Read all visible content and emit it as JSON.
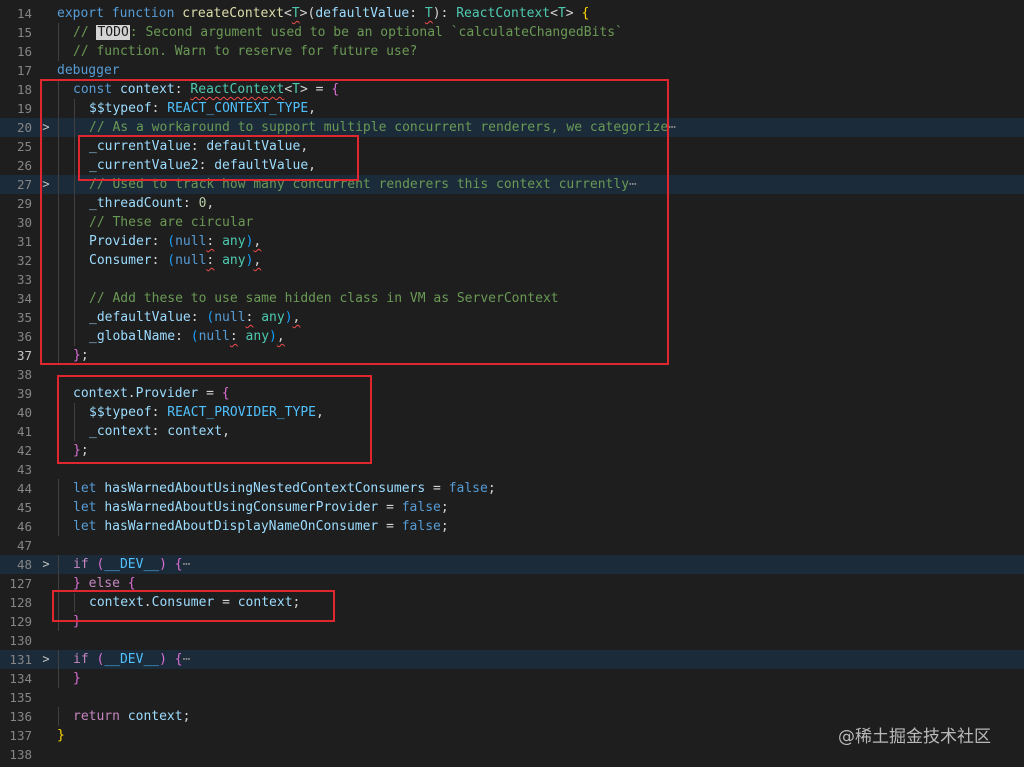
{
  "lines": [
    {
      "num": "14",
      "fold": "",
      "guides": [],
      "folded": false,
      "tokens": [
        {
          "c": "k",
          "t": "export"
        },
        {
          "c": "p",
          "t": " "
        },
        {
          "c": "k",
          "t": "function"
        },
        {
          "c": "p",
          "t": " "
        },
        {
          "c": "f",
          "t": "createContext"
        },
        {
          "c": "p",
          "t": "<"
        },
        {
          "c": "t sq",
          "t": "T"
        },
        {
          "c": "p",
          "t": ">("
        },
        {
          "c": "v",
          "t": "defaultValue"
        },
        {
          "c": "p",
          "t": ": "
        },
        {
          "c": "t sq",
          "t": "T"
        },
        {
          "c": "p",
          "t": "): "
        },
        {
          "c": "t",
          "t": "ReactContext"
        },
        {
          "c": "p",
          "t": "<"
        },
        {
          "c": "t",
          "t": "T"
        },
        {
          "c": "p",
          "t": "> "
        },
        {
          "c": "b1",
          "t": "{"
        }
      ]
    },
    {
      "num": "15",
      "fold": "",
      "guides": [
        16
      ],
      "folded": false,
      "tokens": [
        {
          "c": "c",
          "t": "// "
        },
        {
          "c": "todo",
          "t": "TODO"
        },
        {
          "c": "c",
          "t": ": Second argument used to be an optional `calculateChangedBits`"
        }
      ]
    },
    {
      "num": "16",
      "fold": "",
      "guides": [
        16
      ],
      "folded": false,
      "tokens": [
        {
          "c": "c",
          "t": "// function. Warn to reserve for future use?"
        }
      ]
    },
    {
      "num": "17",
      "fold": "",
      "guides": [],
      "folded": false,
      "tokens": [
        {
          "c": "k",
          "t": "debugger"
        }
      ]
    },
    {
      "num": "18",
      "fold": "",
      "guides": [
        16
      ],
      "folded": false,
      "tokens": [
        {
          "c": "k",
          "t": "const"
        },
        {
          "c": "p",
          "t": " "
        },
        {
          "c": "v",
          "t": "context"
        },
        {
          "c": "p",
          "t": ": "
        },
        {
          "c": "t sq",
          "t": "ReactContext"
        },
        {
          "c": "p",
          "t": "<"
        },
        {
          "c": "t",
          "t": "T"
        },
        {
          "c": "p",
          "t": "> = "
        },
        {
          "c": "b2",
          "t": "{"
        }
      ]
    },
    {
      "num": "19",
      "fold": "",
      "guides": [
        16,
        32
      ],
      "folded": false,
      "tokens": [
        {
          "c": "v",
          "t": "$$typeof"
        },
        {
          "c": "p",
          "t": ": "
        },
        {
          "c": "cst",
          "t": "REACT_CONTEXT_TYPE"
        },
        {
          "c": "p",
          "t": ","
        }
      ]
    },
    {
      "num": "20",
      "fold": ">",
      "guides": [
        16,
        32
      ],
      "folded": true,
      "tokens": [
        {
          "c": "c",
          "t": "// As a workaround to support multiple concurrent renderers, we categorize"
        },
        {
          "c": "ell",
          "t": "⋯"
        }
      ]
    },
    {
      "num": "25",
      "fold": "",
      "guides": [
        16,
        32
      ],
      "folded": false,
      "tokens": [
        {
          "c": "v",
          "t": "_currentValue"
        },
        {
          "c": "p",
          "t": ": "
        },
        {
          "c": "v",
          "t": "defaultValue"
        },
        {
          "c": "p",
          "t": ","
        }
      ]
    },
    {
      "num": "26",
      "fold": "",
      "guides": [
        16,
        32
      ],
      "folded": false,
      "tokens": [
        {
          "c": "v",
          "t": "_currentValue2"
        },
        {
          "c": "p",
          "t": ": "
        },
        {
          "c": "v",
          "t": "defaultValue"
        },
        {
          "c": "p",
          "t": ","
        }
      ]
    },
    {
      "num": "27",
      "fold": ">",
      "guides": [
        16,
        32
      ],
      "folded": true,
      "tokens": [
        {
          "c": "c",
          "t": "// Used to track how many concurrent renderers this context currently"
        },
        {
          "c": "ell",
          "t": "⋯"
        }
      ]
    },
    {
      "num": "29",
      "fold": "",
      "guides": [
        16,
        32
      ],
      "folded": false,
      "tokens": [
        {
          "c": "v",
          "t": "_threadCount"
        },
        {
          "c": "p",
          "t": ": "
        },
        {
          "c": "n",
          "t": "0"
        },
        {
          "c": "p",
          "t": ","
        }
      ]
    },
    {
      "num": "30",
      "fold": "",
      "guides": [
        16,
        32
      ],
      "folded": false,
      "tokens": [
        {
          "c": "c",
          "t": "// These are circular"
        }
      ]
    },
    {
      "num": "31",
      "fold": "",
      "guides": [
        16,
        32
      ],
      "folded": false,
      "tokens": [
        {
          "c": "v",
          "t": "Provider"
        },
        {
          "c": "p",
          "t": ": "
        },
        {
          "c": "b3",
          "t": "("
        },
        {
          "c": "k",
          "t": "null"
        },
        {
          "c": "p sq",
          "t": ":"
        },
        {
          "c": "p",
          "t": " "
        },
        {
          "c": "t",
          "t": "any"
        },
        {
          "c": "b3",
          "t": ")"
        },
        {
          "c": "p sq",
          "t": ","
        }
      ]
    },
    {
      "num": "32",
      "fold": "",
      "guides": [
        16,
        32
      ],
      "folded": false,
      "tokens": [
        {
          "c": "v",
          "t": "Consumer"
        },
        {
          "c": "p",
          "t": ": "
        },
        {
          "c": "b3",
          "t": "("
        },
        {
          "c": "k",
          "t": "null"
        },
        {
          "c": "p sq",
          "t": ":"
        },
        {
          "c": "p",
          "t": " "
        },
        {
          "c": "t",
          "t": "any"
        },
        {
          "c": "b3",
          "t": ")"
        },
        {
          "c": "p sq",
          "t": ","
        }
      ]
    },
    {
      "num": "33",
      "fold": "",
      "guides": [
        16,
        32
      ],
      "folded": false,
      "tokens": []
    },
    {
      "num": "34",
      "fold": "",
      "guides": [
        16,
        32
      ],
      "folded": false,
      "tokens": [
        {
          "c": "c",
          "t": "// Add these to use same hidden class in VM as ServerContext"
        }
      ]
    },
    {
      "num": "35",
      "fold": "",
      "guides": [
        16,
        32
      ],
      "folded": false,
      "tokens": [
        {
          "c": "v",
          "t": "_defaultValue"
        },
        {
          "c": "p",
          "t": ": "
        },
        {
          "c": "b3",
          "t": "("
        },
        {
          "c": "k",
          "t": "null"
        },
        {
          "c": "p sq",
          "t": ":"
        },
        {
          "c": "p",
          "t": " "
        },
        {
          "c": "t",
          "t": "any"
        },
        {
          "c": "b3",
          "t": ")"
        },
        {
          "c": "p sq",
          "t": ","
        }
      ]
    },
    {
      "num": "36",
      "fold": "",
      "guides": [
        16,
        32
      ],
      "folded": false,
      "tokens": [
        {
          "c": "v",
          "t": "_globalName"
        },
        {
          "c": "p",
          "t": ": "
        },
        {
          "c": "b3",
          "t": "("
        },
        {
          "c": "k",
          "t": "null"
        },
        {
          "c": "p sq",
          "t": ":"
        },
        {
          "c": "p",
          "t": " "
        },
        {
          "c": "t",
          "t": "any"
        },
        {
          "c": "b3",
          "t": ")"
        },
        {
          "c": "p sq",
          "t": ","
        }
      ]
    },
    {
      "num": "37",
      "fold": "",
      "guides": [
        16
      ],
      "folded": false,
      "active": true,
      "tokens": [
        {
          "c": "b2",
          "t": "}"
        },
        {
          "c": "p",
          "t": ";"
        }
      ]
    },
    {
      "num": "38",
      "fold": "",
      "guides": [],
      "folded": false,
      "tokens": []
    },
    {
      "num": "39",
      "fold": "",
      "guides": [
        16
      ],
      "folded": false,
      "tokens": [
        {
          "c": "v",
          "t": "context"
        },
        {
          "c": "p",
          "t": "."
        },
        {
          "c": "v",
          "t": "Provider"
        },
        {
          "c": "p",
          "t": " = "
        },
        {
          "c": "b2",
          "t": "{"
        }
      ]
    },
    {
      "num": "40",
      "fold": "",
      "guides": [
        16,
        32
      ],
      "folded": false,
      "tokens": [
        {
          "c": "v",
          "t": "$$typeof"
        },
        {
          "c": "p",
          "t": ": "
        },
        {
          "c": "cst",
          "t": "REACT_PROVIDER_TYPE"
        },
        {
          "c": "p",
          "t": ","
        }
      ]
    },
    {
      "num": "41",
      "fold": "",
      "guides": [
        16,
        32
      ],
      "folded": false,
      "tokens": [
        {
          "c": "v",
          "t": "_context"
        },
        {
          "c": "p",
          "t": ": "
        },
        {
          "c": "v",
          "t": "context"
        },
        {
          "c": "p",
          "t": ","
        }
      ]
    },
    {
      "num": "42",
      "fold": "",
      "guides": [
        16
      ],
      "folded": false,
      "tokens": [
        {
          "c": "b2",
          "t": "}"
        },
        {
          "c": "p",
          "t": ";"
        }
      ]
    },
    {
      "num": "43",
      "fold": "",
      "guides": [],
      "folded": false,
      "tokens": []
    },
    {
      "num": "44",
      "fold": "",
      "guides": [
        16
      ],
      "folded": false,
      "tokens": [
        {
          "c": "k",
          "t": "let"
        },
        {
          "c": "p",
          "t": " "
        },
        {
          "c": "v",
          "t": "hasWarnedAboutUsingNestedContextConsumers"
        },
        {
          "c": "p",
          "t": " = "
        },
        {
          "c": "k",
          "t": "false"
        },
        {
          "c": "p",
          "t": ";"
        }
      ]
    },
    {
      "num": "45",
      "fold": "",
      "guides": [
        16
      ],
      "folded": false,
      "tokens": [
        {
          "c": "k",
          "t": "let"
        },
        {
          "c": "p",
          "t": " "
        },
        {
          "c": "v",
          "t": "hasWarnedAboutUsingConsumerProvider"
        },
        {
          "c": "p",
          "t": " = "
        },
        {
          "c": "k",
          "t": "false"
        },
        {
          "c": "p",
          "t": ";"
        }
      ]
    },
    {
      "num": "46",
      "fold": "",
      "guides": [
        16
      ],
      "folded": false,
      "tokens": [
        {
          "c": "k",
          "t": "let"
        },
        {
          "c": "p",
          "t": " "
        },
        {
          "c": "v",
          "t": "hasWarnedAboutDisplayNameOnConsumer"
        },
        {
          "c": "p",
          "t": " = "
        },
        {
          "c": "k",
          "t": "false"
        },
        {
          "c": "p",
          "t": ";"
        }
      ]
    },
    {
      "num": "47",
      "fold": "",
      "guides": [],
      "folded": false,
      "tokens": []
    },
    {
      "num": "48",
      "fold": ">",
      "guides": [
        16
      ],
      "folded": true,
      "tokens": [
        {
          "c": "ctl",
          "t": "if"
        },
        {
          "c": "p",
          "t": " "
        },
        {
          "c": "b2",
          "t": "("
        },
        {
          "c": "cst",
          "t": "__DEV__"
        },
        {
          "c": "b2",
          "t": ")"
        },
        {
          "c": "p",
          "t": " "
        },
        {
          "c": "b2",
          "t": "{"
        },
        {
          "c": "ell",
          "t": "⋯"
        }
      ]
    },
    {
      "num": "127",
      "fold": "",
      "guides": [
        16
      ],
      "folded": false,
      "tokens": [
        {
          "c": "b2",
          "t": "}"
        },
        {
          "c": "p",
          "t": " "
        },
        {
          "c": "ctl",
          "t": "else"
        },
        {
          "c": "p",
          "t": " "
        },
        {
          "c": "b2",
          "t": "{"
        }
      ]
    },
    {
      "num": "128",
      "fold": "",
      "guides": [
        16,
        32
      ],
      "folded": false,
      "tokens": [
        {
          "c": "v",
          "t": "context"
        },
        {
          "c": "p",
          "t": "."
        },
        {
          "c": "v",
          "t": "Consumer"
        },
        {
          "c": "p",
          "t": " = "
        },
        {
          "c": "v",
          "t": "context"
        },
        {
          "c": "p",
          "t": ";"
        }
      ]
    },
    {
      "num": "129",
      "fold": "",
      "guides": [
        16
      ],
      "folded": false,
      "tokens": [
        {
          "c": "b2",
          "t": "}"
        }
      ]
    },
    {
      "num": "130",
      "fold": "",
      "guides": [],
      "folded": false,
      "tokens": []
    },
    {
      "num": "131",
      "fold": ">",
      "guides": [
        16
      ],
      "folded": true,
      "tokens": [
        {
          "c": "ctl",
          "t": "if"
        },
        {
          "c": "p",
          "t": " "
        },
        {
          "c": "b2",
          "t": "("
        },
        {
          "c": "cst",
          "t": "__DEV__"
        },
        {
          "c": "b2",
          "t": ")"
        },
        {
          "c": "p",
          "t": " "
        },
        {
          "c": "b2",
          "t": "{"
        },
        {
          "c": "ell",
          "t": "⋯"
        }
      ]
    },
    {
      "num": "134",
      "fold": "",
      "guides": [
        16
      ],
      "folded": false,
      "tokens": [
        {
          "c": "b2",
          "t": "}"
        }
      ]
    },
    {
      "num": "135",
      "fold": "",
      "guides": [],
      "folded": false,
      "tokens": []
    },
    {
      "num": "136",
      "fold": "",
      "guides": [
        16
      ],
      "folded": false,
      "tokens": [
        {
          "c": "ctl",
          "t": "return"
        },
        {
          "c": "p",
          "t": " "
        },
        {
          "c": "v",
          "t": "context"
        },
        {
          "c": "p",
          "t": ";"
        }
      ]
    },
    {
      "num": "137",
      "fold": "",
      "guides": [],
      "folded": false,
      "tokens": [
        {
          "c": "b1",
          "t": "}"
        }
      ]
    },
    {
      "num": "138",
      "fold": "",
      "guides": [],
      "folded": false,
      "tokens": []
    }
  ],
  "indent": [
    0,
    1,
    1,
    0,
    1,
    2,
    2,
    2,
    2,
    2,
    2,
    2,
    2,
    2,
    2,
    2,
    2,
    2,
    1,
    0,
    1,
    2,
    2,
    1,
    0,
    1,
    1,
    1,
    0,
    1,
    1,
    2,
    1,
    0,
    1,
    1,
    0,
    1,
    0,
    0
  ],
  "colors": {
    "highlight_box": "#e0262f",
    "background": "#1e1e1e"
  },
  "watermark": "@稀土掘金技术社区"
}
